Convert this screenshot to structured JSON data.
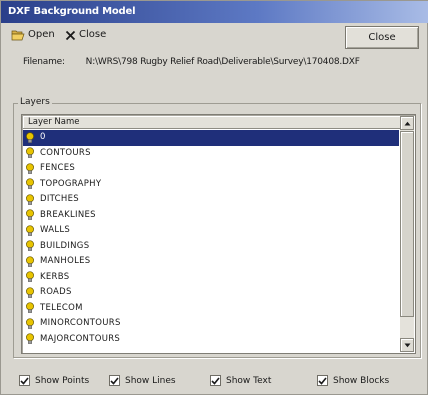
{
  "window": {
    "title": "DXF Background Model"
  },
  "toolbar": {
    "open_label": "Open",
    "close_label": "Close",
    "dialog_close_label": "Close"
  },
  "file": {
    "label": "Filename:",
    "value": "N:\\WRS\\798 Rugby Relief Road\\Deliverable\\Survey\\170408.DXF"
  },
  "layers": {
    "group_label": "Layers",
    "column_header": "Layer Name",
    "items": [
      {
        "name": "0",
        "selected": true
      },
      {
        "name": "CONTOURS",
        "selected": false
      },
      {
        "name": "FENCES",
        "selected": false
      },
      {
        "name": "TOPOGRAPHY",
        "selected": false
      },
      {
        "name": "DITCHES",
        "selected": false
      },
      {
        "name": "BREAKLINES",
        "selected": false
      },
      {
        "name": "WALLS",
        "selected": false
      },
      {
        "name": "BUILDINGS",
        "selected": false
      },
      {
        "name": "MANHOLES",
        "selected": false
      },
      {
        "name": "KERBS",
        "selected": false
      },
      {
        "name": "ROADS",
        "selected": false
      },
      {
        "name": "TELECOM",
        "selected": false
      },
      {
        "name": "MINORCONTOURS",
        "selected": false
      },
      {
        "name": "MAJORCONTOURS",
        "selected": false
      }
    ]
  },
  "options": {
    "show_points": {
      "label": "Show Points",
      "checked": true
    },
    "show_lines": {
      "label": "Show Lines",
      "checked": true
    },
    "show_text": {
      "label": "Show Text",
      "checked": true
    },
    "show_blocks": {
      "label": "Show Blocks",
      "checked": true
    }
  },
  "colors": {
    "selection": "#1f2f7a",
    "bulb": "#e8c400",
    "titlebar_start": "#2a3f8a"
  }
}
